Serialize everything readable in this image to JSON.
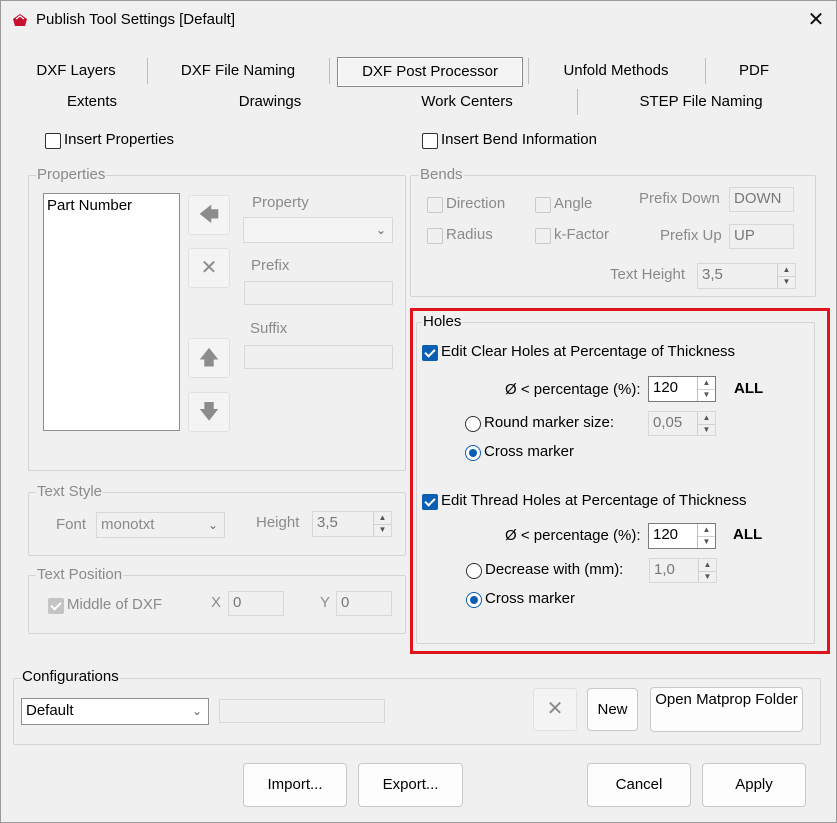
{
  "window": {
    "title": "Publish Tool Settings  [Default]"
  },
  "tabs": {
    "row1": [
      "DXF Layers",
      "DXF File Naming",
      "DXF Post Processor",
      "Unfold Methods",
      "PDF"
    ],
    "row2": [
      "Extents",
      "Drawings",
      "Work Centers",
      "STEP File Naming"
    ]
  },
  "options": {
    "insert_properties": "Insert Properties",
    "insert_bend_info": "Insert Bend Information"
  },
  "properties": {
    "group_label": "Properties",
    "items": [
      "Part Number"
    ],
    "property_label": "Property",
    "prefix_label": "Prefix",
    "suffix_label": "Suffix"
  },
  "bends": {
    "group_label": "Bends",
    "direction": "Direction",
    "angle": "Angle",
    "radius": "Radius",
    "kfactor": "k-Factor",
    "prefix_down_label": "Prefix Down",
    "prefix_down_value": "DOWN",
    "prefix_up_label": "Prefix Up",
    "prefix_up_value": "UP",
    "text_height_label": "Text Height",
    "text_height_value": "3,5"
  },
  "holes": {
    "group_label": "Holes",
    "clear": {
      "label": "Edit Clear Holes at Percentage of Thickness",
      "pct_label": "Ø < percentage (%):",
      "pct_value": "120",
      "all": "ALL",
      "round_label": "Round marker size:",
      "round_value": "0,05",
      "cross_label": "Cross marker"
    },
    "thread": {
      "label": "Edit Thread Holes at Percentage of Thickness",
      "pct_label": "Ø < percentage (%):",
      "pct_value": "120",
      "all": "ALL",
      "decrease_label": "Decrease with (mm):",
      "decrease_value": "1,0",
      "cross_label": "Cross marker"
    }
  },
  "text_style": {
    "group_label": "Text Style",
    "font_label": "Font",
    "font_value": "monotxt",
    "height_label": "Height",
    "height_value": "3,5"
  },
  "text_position": {
    "group_label": "Text Position",
    "middle_label": "Middle of DXF",
    "x_label": "X",
    "x_value": "0",
    "y_label": "Y",
    "y_value": "0"
  },
  "configurations": {
    "group_label": "Configurations",
    "selected": "Default",
    "new_label": "New",
    "open_matprop_label": "Open Matprop Folder"
  },
  "footer": {
    "import": "Import...",
    "export": "Export...",
    "cancel": "Cancel",
    "apply": "Apply"
  },
  "colors": {
    "highlight": "#e0141c",
    "accent": "#0a5fb4"
  }
}
